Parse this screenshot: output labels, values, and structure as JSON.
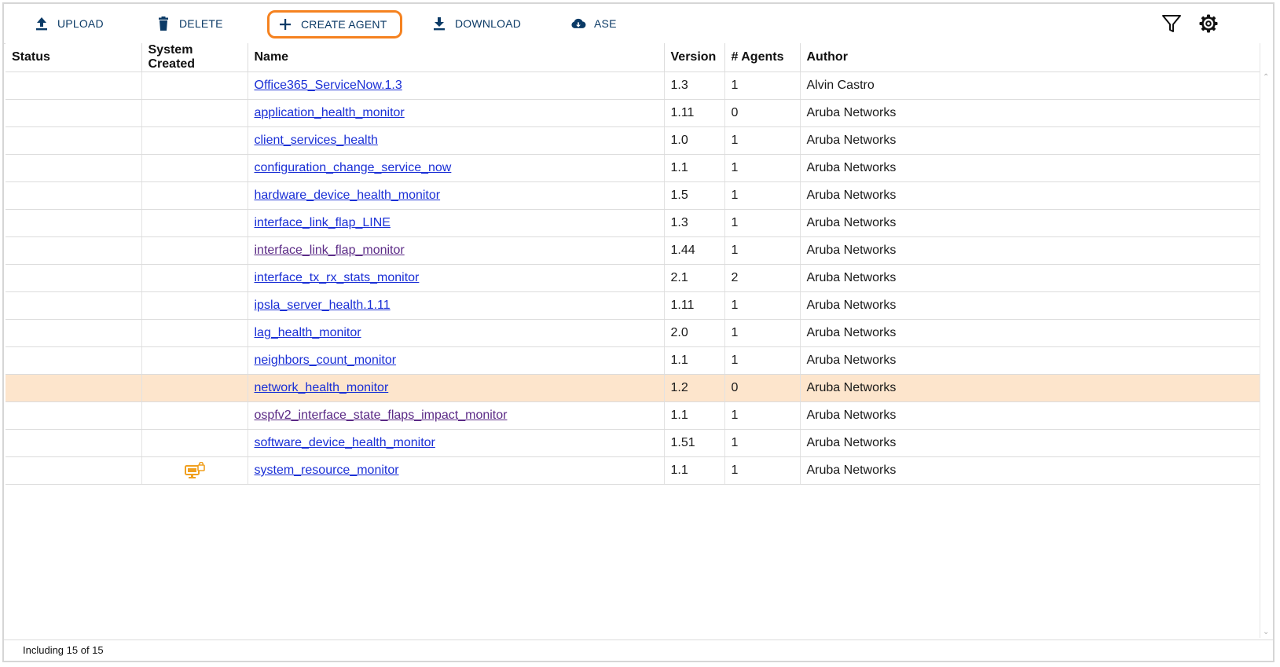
{
  "toolbar": {
    "upload_label": "UPLOAD",
    "delete_label": "DELETE",
    "create_label": "CREATE AGENT",
    "download_label": "DOWNLOAD",
    "ase_label": "ASE",
    "icons": {
      "upload": "upload-icon",
      "delete": "trash-icon",
      "create": "plus-icon",
      "download": "download-icon",
      "ase": "cloud-download-icon",
      "filter": "filter-icon",
      "settings": "gear-icon"
    },
    "accent_color": "#0b3a66",
    "highlight_color": "#f58220"
  },
  "table": {
    "columns": [
      "Status",
      "System Created",
      "Name",
      "Version",
      "# Agents",
      "Author"
    ],
    "selected_row_color": "#fde5cc",
    "rows": [
      {
        "status": "",
        "system_created": "",
        "name": "Office365_ServiceNow.1.3",
        "version": "1.3",
        "agents": "1",
        "author": "Alvin Castro"
      },
      {
        "status": "",
        "system_created": "",
        "name": "application_health_monitor",
        "version": "1.11",
        "agents": "0",
        "author": "Aruba Networks"
      },
      {
        "status": "",
        "system_created": "",
        "name": "client_services_health",
        "version": "1.0",
        "agents": "1",
        "author": "Aruba Networks"
      },
      {
        "status": "",
        "system_created": "",
        "name": "configuration_change_service_now",
        "version": "1.1",
        "agents": "1",
        "author": "Aruba Networks"
      },
      {
        "status": "",
        "system_created": "",
        "name": "hardware_device_health_monitor",
        "version": "1.5",
        "agents": "1",
        "author": "Aruba Networks"
      },
      {
        "status": "",
        "system_created": "",
        "name": "interface_link_flap_LINE",
        "version": "1.3",
        "agents": "1",
        "author": "Aruba Networks"
      },
      {
        "status": "",
        "system_created": "",
        "name": "interface_link_flap_monitor",
        "version": "1.44",
        "agents": "1",
        "author": "Aruba Networks"
      },
      {
        "status": "",
        "system_created": "",
        "name": "interface_tx_rx_stats_monitor",
        "version": "2.1",
        "agents": "2",
        "author": "Aruba Networks"
      },
      {
        "status": "",
        "system_created": "",
        "name": "ipsla_server_health.1.11",
        "version": "1.11",
        "agents": "1",
        "author": "Aruba Networks"
      },
      {
        "status": "",
        "system_created": "",
        "name": "lag_health_monitor",
        "version": "2.0",
        "agents": "1",
        "author": "Aruba Networks"
      },
      {
        "status": "",
        "system_created": "",
        "name": "neighbors_count_monitor",
        "version": "1.1",
        "agents": "1",
        "author": "Aruba Networks"
      },
      {
        "status": "",
        "system_created": "",
        "name": "network_health_monitor",
        "version": "1.2",
        "agents": "0",
        "author": "Aruba Networks"
      },
      {
        "status": "",
        "system_created": "",
        "name": "ospfv2_interface_state_flaps_impact_monitor",
        "version": "1.1",
        "agents": "1",
        "author": "Aruba Networks"
      },
      {
        "status": "",
        "system_created": "",
        "name": "software_device_health_monitor",
        "version": "1.51",
        "agents": "1",
        "author": "Aruba Networks"
      },
      {
        "status": "",
        "system_created": "system-locked-icon",
        "name": "system_resource_monitor",
        "version": "1.1",
        "agents": "1",
        "author": "Aruba Networks"
      }
    ]
  },
  "footer": {
    "summary": "Including 15 of 15"
  }
}
